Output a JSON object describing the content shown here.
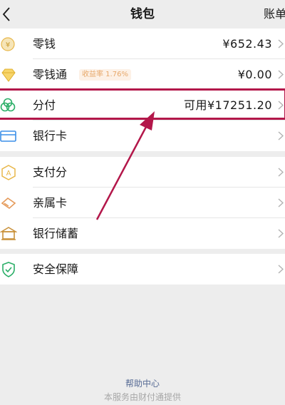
{
  "header": {
    "title": "钱包",
    "bill_label": "账单"
  },
  "group1": {
    "items": [
      {
        "label": "零钱",
        "value": "¥652.43",
        "icon": "coin-icon"
      },
      {
        "label": "零钱通",
        "badge": "收益率 1.76%",
        "value": "¥0.00",
        "icon": "diamond-icon"
      },
      {
        "label": "分付",
        "value": "可用¥17251.20",
        "icon": "fenfu-icon"
      },
      {
        "label": "银行卡",
        "value": "",
        "icon": "bank-card-icon"
      }
    ]
  },
  "group2": {
    "items": [
      {
        "label": "支付分",
        "icon": "pay-score-icon"
      },
      {
        "label": "亲属卡",
        "icon": "family-card-icon"
      },
      {
        "label": "银行储蓄",
        "icon": "bank-savings-icon"
      }
    ]
  },
  "group3": {
    "items": [
      {
        "label": "安全保障",
        "icon": "shield-icon"
      }
    ]
  },
  "footer": {
    "help": "帮助中心",
    "note": "本服务由财付通提供"
  },
  "colors": {
    "accent_gold": "#e8b74a",
    "accent_green": "#2aae67",
    "annotation_red": "#b3174a",
    "link_blue": "#576b95"
  }
}
